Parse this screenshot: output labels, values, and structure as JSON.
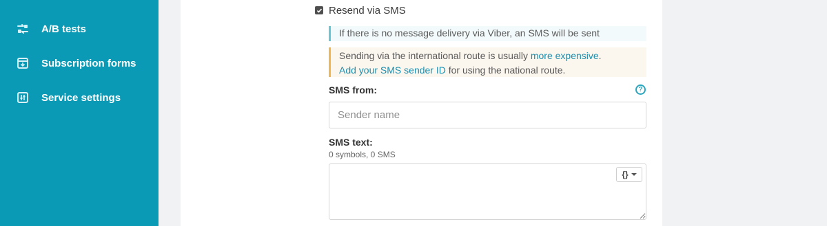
{
  "sidebar": {
    "items": [
      {
        "label": "A/B tests",
        "icon": "ab-tests-icon"
      },
      {
        "label": "Subscription forms",
        "icon": "subscription-form-icon"
      },
      {
        "label": "Service settings",
        "icon": "sliders-icon"
      }
    ]
  },
  "form": {
    "resend_checkbox": {
      "label": "Resend via SMS",
      "checked": true
    },
    "info_note": "If there is no message delivery via Viber, an SMS will be sent",
    "warning_note": {
      "text1": "Sending via the international route is usually ",
      "link1": "more expensive",
      "text2": ".",
      "link2": "Add your SMS sender ID",
      "text3": " for using the national route."
    },
    "sms_from": {
      "label": "SMS from:",
      "placeholder": "Sender name",
      "value": ""
    },
    "sms_text": {
      "label": "SMS text:",
      "counter": "0 symbols, 0 SMS",
      "value": "",
      "variable_button": "{}"
    }
  },
  "colors": {
    "sidebar_bg": "#0a9ab5",
    "link": "#1a8fb0",
    "info_border": "#68c5d4",
    "warning_border": "#f0b64f"
  }
}
